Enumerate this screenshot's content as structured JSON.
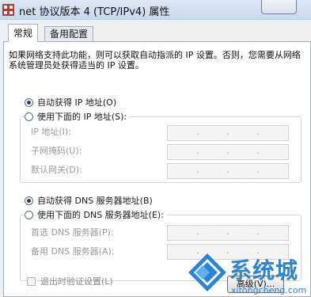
{
  "window": {
    "title": "net 协议版本 4 (TCP/IPv4) 属性",
    "close_label": ""
  },
  "tabs": [
    {
      "label": "常规",
      "active": true
    },
    {
      "label": "备用配置",
      "active": false
    }
  ],
  "description": "如果网络支持此功能，则可以获取自动指派的 IP 设置。否则，您需要从网络系统管理员处获得适当的 IP 设置。",
  "ip_section": {
    "auto_label": "自动获得 IP 地址(O)",
    "manual_label": "使用下面的 IP 地址(S):",
    "auto_selected": true,
    "fields": [
      {
        "label": "IP 地址(I):"
      },
      {
        "label": "子网掩码(U):"
      },
      {
        "label": "默认网关(D):"
      }
    ]
  },
  "dns_section": {
    "auto_label": "自动获得 DNS 服务器地址(B)",
    "manual_label": "使用下面的 DNS 服务器地址(E):",
    "auto_selected": true,
    "fields": [
      {
        "label": "首选 DNS 服务器(P):"
      },
      {
        "label": "备用 DNS 服务器(A):"
      }
    ]
  },
  "validate_on_exit": {
    "label": "退出时验证设置(L)",
    "checked": false
  },
  "advanced_button": "高级(V)...",
  "watermark": {
    "brand": "系统城",
    "url": "xitongcheng.com"
  },
  "colors": {
    "title_bar": "#c9d9ee",
    "panel_bg": "#ffffff",
    "disabled_text": "#9a9a9a",
    "watermark_blue": "#2b84d4"
  }
}
